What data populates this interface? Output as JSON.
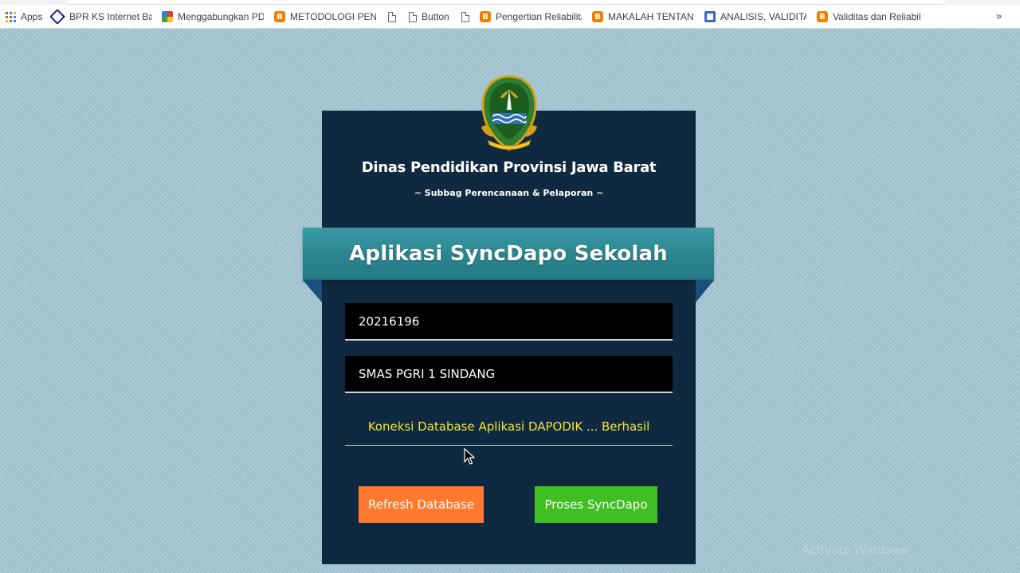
{
  "browser": {
    "bookmarks": [
      {
        "label": "Apps",
        "icon": "apps-grid-icon"
      },
      {
        "label": "BPR KS Internet Bank",
        "icon": "bank-diamond-icon"
      },
      {
        "label": "Menggabungkan PDF",
        "icon": "pdf-merge-icon"
      },
      {
        "label": "METODOLOGI PENEL",
        "icon": "blogger-icon"
      },
      {
        "label": "",
        "icon": "document-icon"
      },
      {
        "label": "Button",
        "icon": "document-icon"
      },
      {
        "label": "",
        "icon": "document-icon"
      },
      {
        "label": "Pengertian Reliabilitas",
        "icon": "blogger-icon"
      },
      {
        "label": "MAKALAH TENTANG",
        "icon": "blogger-icon"
      },
      {
        "label": "ANALISIS, VALIDITAS,",
        "icon": "google-docs-icon"
      },
      {
        "label": "Validitas dan Reliabilit",
        "icon": "blogger-icon"
      }
    ],
    "more_label": "»",
    "blogger_glyph": "B"
  },
  "header": {
    "org_title": "Dinas Pendidikan Provinsi Jawa Barat",
    "org_subtitle": "~ Subbag Perencanaan & Pelaporan ~",
    "logo_icon": "jawa-barat-emblem-icon"
  },
  "app": {
    "title": "Aplikasi SyncDapo Sekolah",
    "npsn_value": "20216196",
    "school_value": "SMAS PGRI 1 SINDANG",
    "status_text": "Koneksi Database Aplikasi DAPODIK ... Berhasil",
    "refresh_label": "Refresh Database",
    "sync_label": "Proses SyncDapo"
  },
  "colors": {
    "page_background": "#a4c7d4",
    "card_background": "#0f2a40",
    "ribbon": "#2b8590",
    "status_text": "#f2e535",
    "refresh_button": "#ff7a2f",
    "sync_button": "#3fbf22"
  },
  "watermark": "Activate Windows"
}
